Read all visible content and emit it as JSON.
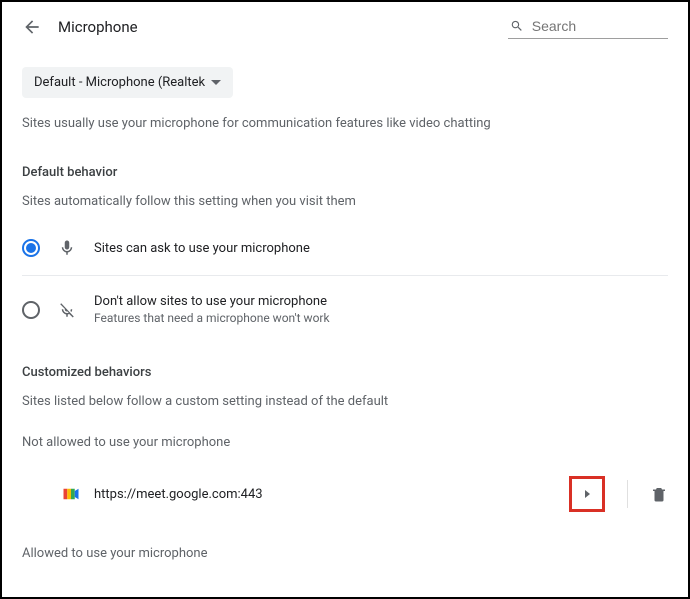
{
  "header": {
    "title": "Microphone",
    "search_placeholder": "Search"
  },
  "dropdown": {
    "label": "Default - Microphone (Realtek"
  },
  "intro": "Sites usually use your microphone for communication features like video chatting",
  "default_section": {
    "title": "Default behavior",
    "desc": "Sites automatically follow this setting when you visit them",
    "opt1": "Sites can ask to use your microphone",
    "opt2_title": "Don't allow sites to use your microphone",
    "opt2_sub": "Features that need a microphone won't work"
  },
  "custom_section": {
    "title": "Customized behaviors",
    "desc": "Sites listed below follow a custom setting instead of the default",
    "not_allowed_label": "Not allowed to use your microphone",
    "allowed_label": "Allowed to use your microphone",
    "site1": "https://meet.google.com:443"
  }
}
